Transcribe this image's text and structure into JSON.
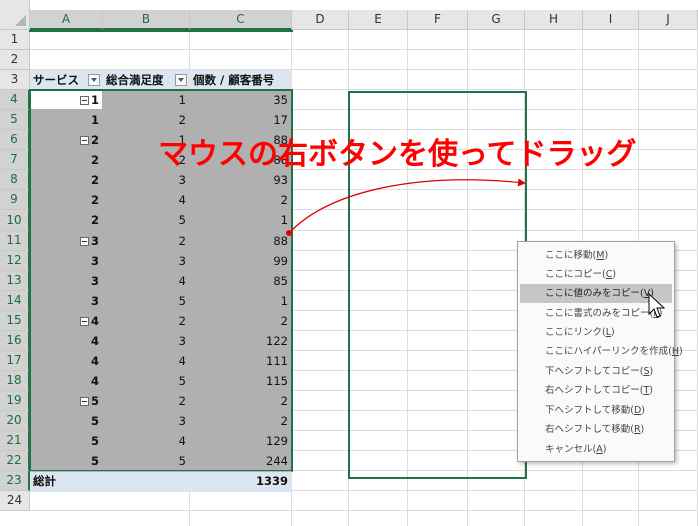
{
  "columns": [
    "A",
    "B",
    "C",
    "D",
    "E",
    "F",
    "G",
    "H",
    "I",
    "J"
  ],
  "rows": [
    "1",
    "2",
    "3",
    "4",
    "5",
    "6",
    "7",
    "8",
    "9",
    "10",
    "11",
    "12",
    "13",
    "14",
    "15",
    "16",
    "17",
    "18",
    "19",
    "20",
    "21",
    "22",
    "23",
    "24"
  ],
  "pivot": {
    "headers": {
      "service": "サービス",
      "satisfaction": "総合満足度",
      "value_field": "個数 / 顧客番号"
    },
    "rows": [
      {
        "service": "1",
        "satisfaction": "1",
        "count": "35",
        "group_start": true
      },
      {
        "service": "1",
        "satisfaction": "2",
        "count": "17",
        "group_start": false
      },
      {
        "service": "2",
        "satisfaction": "1",
        "count": "88",
        "group_start": true
      },
      {
        "service": "2",
        "satisfaction": "2",
        "count": "88",
        "group_start": false
      },
      {
        "service": "2",
        "satisfaction": "3",
        "count": "93",
        "group_start": false
      },
      {
        "service": "2",
        "satisfaction": "4",
        "count": "2",
        "group_start": false
      },
      {
        "service": "2",
        "satisfaction": "5",
        "count": "1",
        "group_start": false
      },
      {
        "service": "3",
        "satisfaction": "2",
        "count": "88",
        "group_start": true
      },
      {
        "service": "3",
        "satisfaction": "3",
        "count": "99",
        "group_start": false
      },
      {
        "service": "3",
        "satisfaction": "4",
        "count": "85",
        "group_start": false
      },
      {
        "service": "3",
        "satisfaction": "5",
        "count": "1",
        "group_start": false
      },
      {
        "service": "4",
        "satisfaction": "2",
        "count": "2",
        "group_start": true
      },
      {
        "service": "4",
        "satisfaction": "3",
        "count": "122",
        "group_start": false
      },
      {
        "service": "4",
        "satisfaction": "4",
        "count": "111",
        "group_start": false
      },
      {
        "service": "4",
        "satisfaction": "5",
        "count": "115",
        "group_start": false
      },
      {
        "service": "5",
        "satisfaction": "2",
        "count": "2",
        "group_start": true
      },
      {
        "service": "5",
        "satisfaction": "3",
        "count": "2",
        "group_start": false
      },
      {
        "service": "5",
        "satisfaction": "4",
        "count": "129",
        "group_start": false
      },
      {
        "service": "5",
        "satisfaction": "5",
        "count": "244",
        "group_start": false
      }
    ],
    "total": {
      "label": "総計",
      "value": "1339"
    }
  },
  "annotation": {
    "title": "マウスの右ボタンを使ってドラッグ",
    "color": "#ff0000"
  },
  "context_menu": {
    "items": [
      {
        "label": "ここに移動",
        "key": "M",
        "highlighted": false
      },
      {
        "label": "ここにコピー",
        "key": "C",
        "highlighted": false
      },
      {
        "label": "ここに値のみをコピー",
        "key": "V",
        "highlighted": true
      },
      {
        "label": "ここに書式のみをコピー",
        "key": "F",
        "highlighted": false
      },
      {
        "label": "ここにリンク",
        "key": "L",
        "highlighted": false
      },
      {
        "label": "ここにハイパーリンクを作成",
        "key": "H",
        "highlighted": false
      },
      {
        "label": "下へシフトしてコピー",
        "key": "S",
        "highlighted": false
      },
      {
        "label": "右へシフトしてコピー",
        "key": "T",
        "highlighted": false
      },
      {
        "label": "下へシフトして移動",
        "key": "D",
        "highlighted": false
      },
      {
        "label": "右へシフトして移動",
        "key": "R",
        "highlighted": false
      },
      {
        "label": "キャンセル",
        "key": "A",
        "highlighted": false
      }
    ]
  },
  "colors": {
    "selection_green": "#217346",
    "pivot_header_blue": "#dce6f1",
    "annotation_red": "#ff0000"
  }
}
